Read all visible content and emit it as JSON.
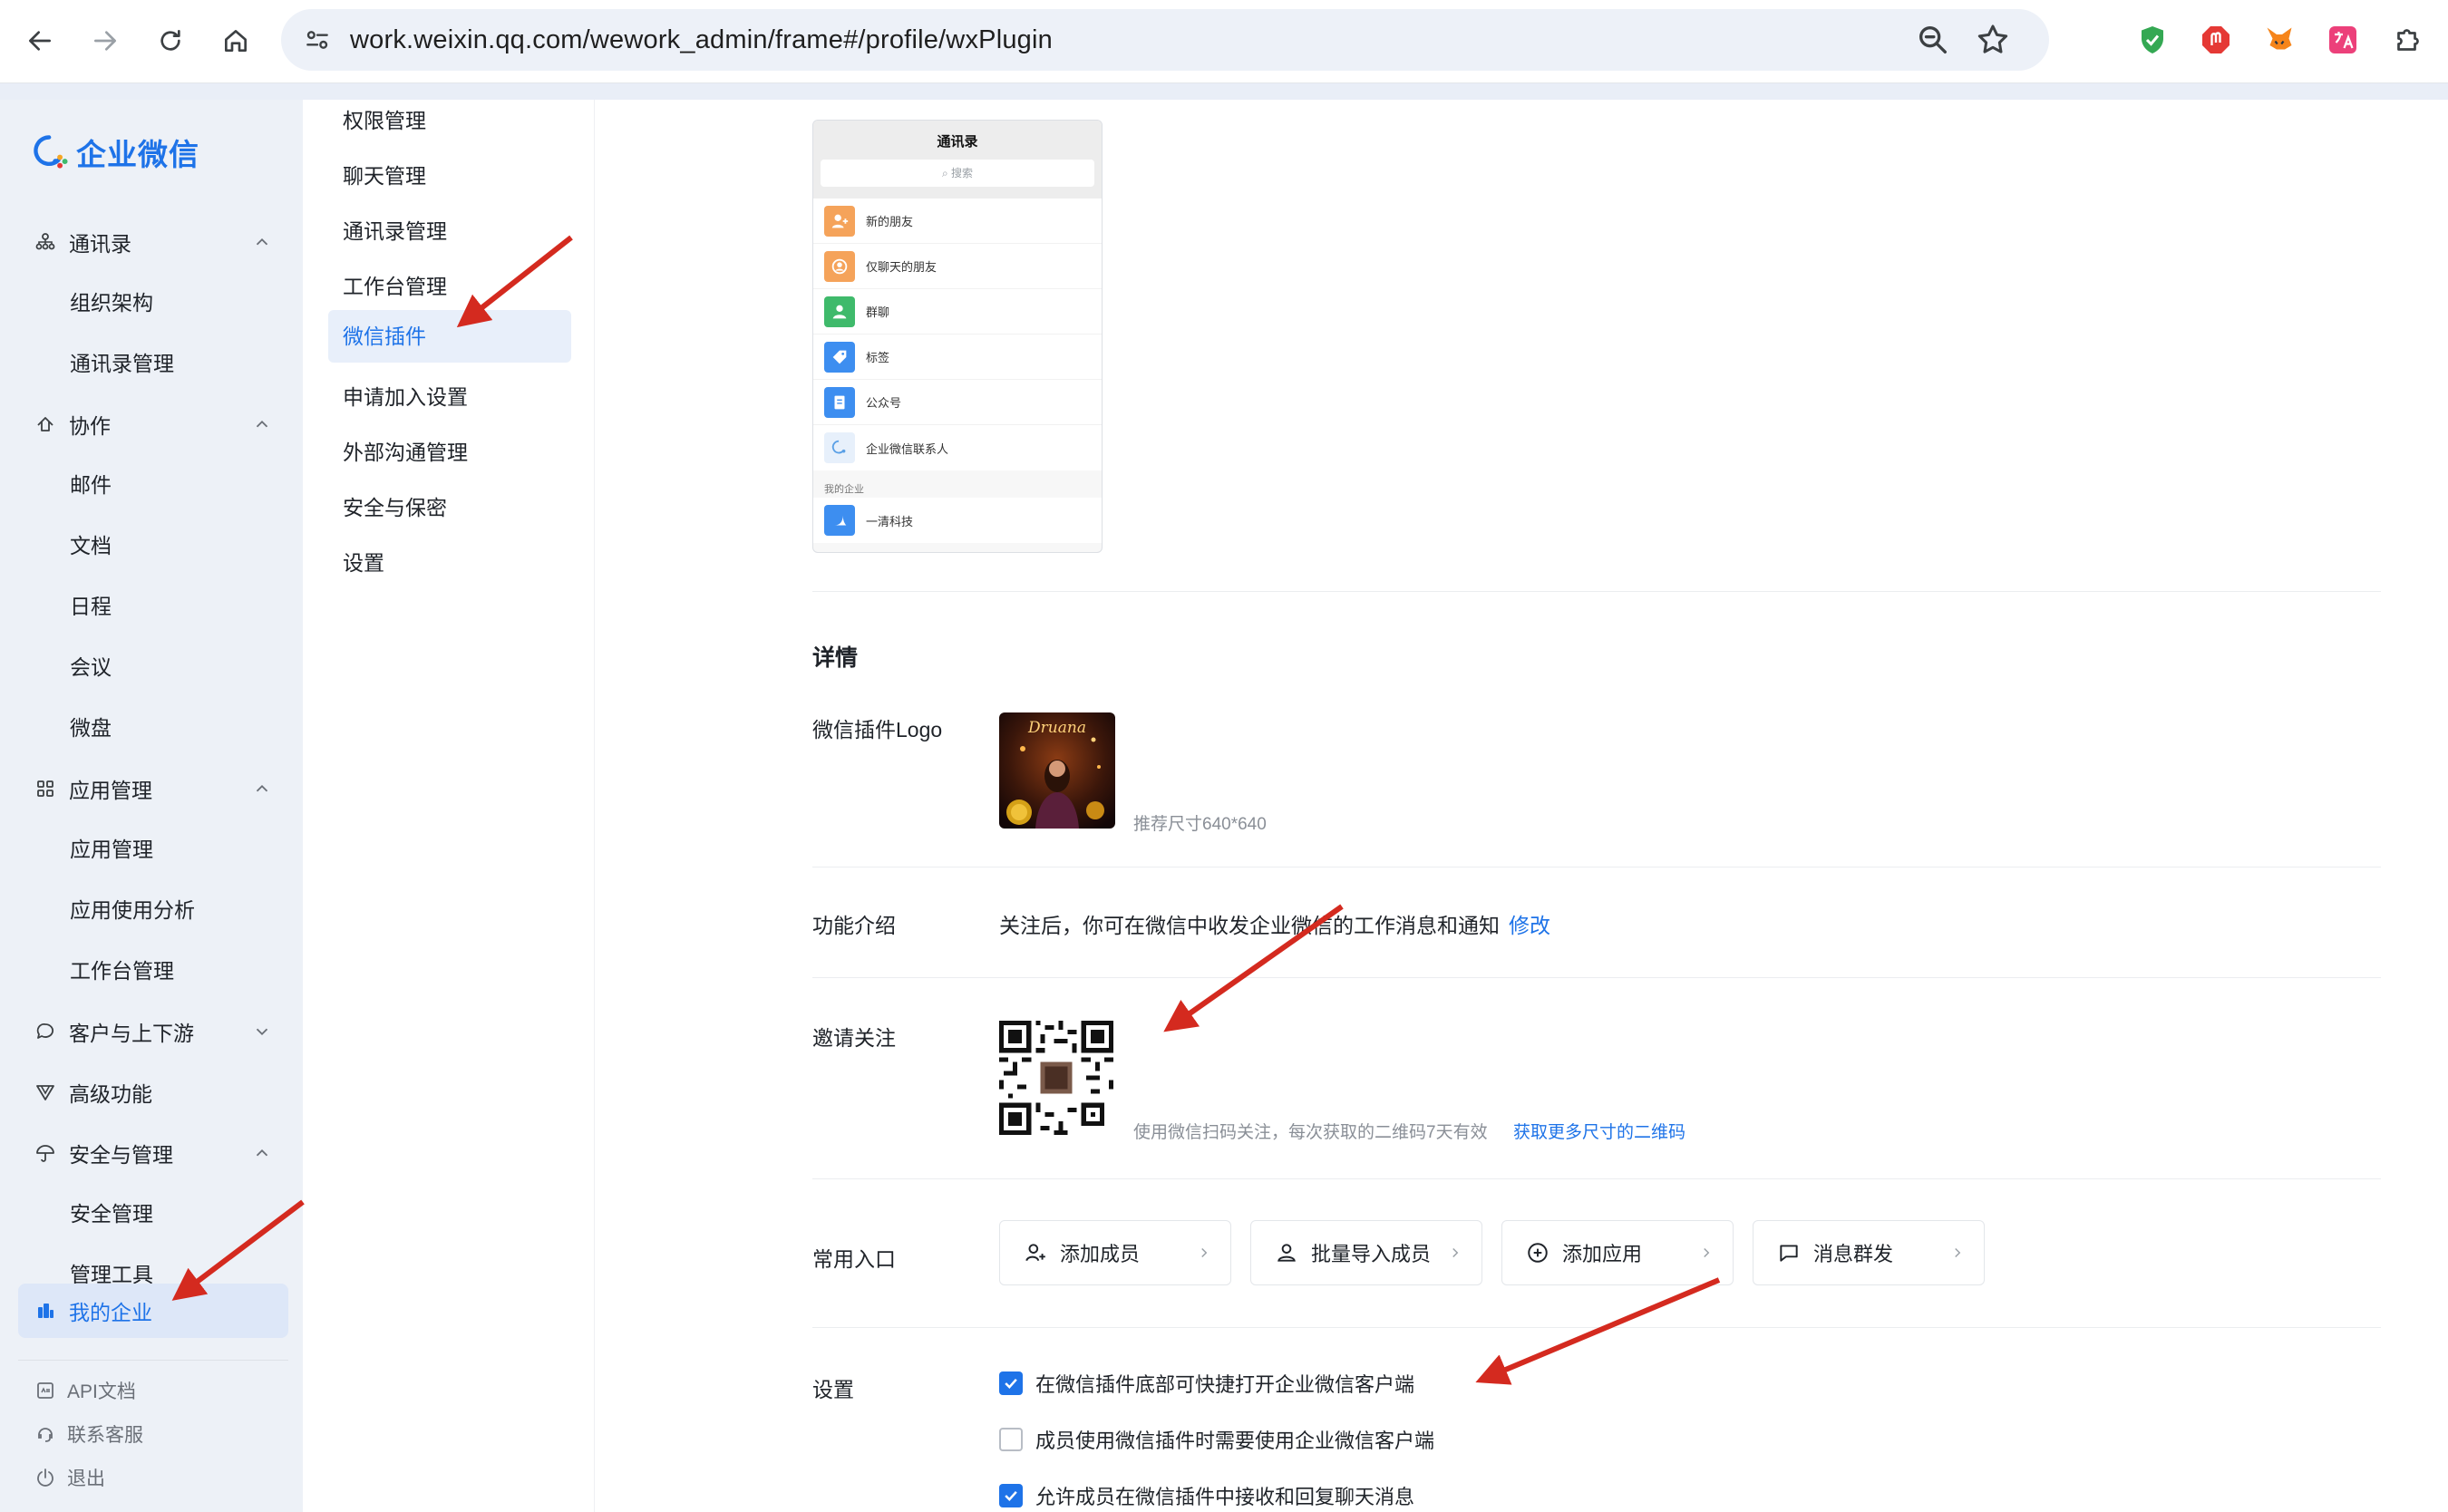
{
  "browser": {
    "url": "work.weixin.qq.com/wework_admin/frame#/profile/wxPlugin"
  },
  "brand": {
    "name": "企业微信",
    "accent": "#1e73e8"
  },
  "sidebar": {
    "groups": [
      {
        "label": "通讯录",
        "icon": "contacts-icon",
        "expanded": true,
        "items": [
          "组织架构",
          "通讯录管理"
        ]
      },
      {
        "label": "协作",
        "icon": "collaborate-icon",
        "expanded": true,
        "items": [
          "邮件",
          "文档",
          "日程",
          "会议",
          "微盘"
        ]
      },
      {
        "label": "应用管理",
        "icon": "apps-grid-icon",
        "expanded": true,
        "items": [
          "应用管理",
          "应用使用分析",
          "工作台管理"
        ]
      },
      {
        "label": "客户与上下游",
        "icon": "chat-bubble-icon",
        "expanded": false,
        "items": []
      },
      {
        "label": "高级功能",
        "icon": "advanced-icon",
        "expanded": false,
        "items": []
      },
      {
        "label": "安全与管理",
        "icon": "umbrella-icon",
        "expanded": true,
        "items": [
          "安全管理",
          "管理工具"
        ]
      }
    ],
    "active": "我的企业",
    "footer": [
      "API文档",
      "联系客服",
      "退出"
    ]
  },
  "subnav": {
    "items": [
      "权限管理",
      "聊天管理",
      "通讯录管理",
      "工作台管理",
      "微信插件",
      "申请加入设置",
      "外部沟通管理",
      "安全与保密",
      "设置"
    ],
    "active": "微信插件"
  },
  "preview": {
    "title": "通讯录",
    "search": "搜索",
    "rows": [
      {
        "label": "新的朋友",
        "color": "#f5a35a"
      },
      {
        "label": "仅聊天的朋友",
        "color": "#f5a35a"
      },
      {
        "label": "群聊",
        "color": "#3fba6b"
      },
      {
        "label": "标签",
        "color": "#3d8ef0"
      },
      {
        "label": "公众号",
        "color": "#3d8ef0"
      },
      {
        "label": "企业微信联系人",
        "color": "#5aa0e6"
      }
    ],
    "section": "我的企业",
    "company": "一清科技"
  },
  "details": {
    "title": "详情",
    "logo_label": "微信插件Logo",
    "logo_image_text": "Druana",
    "logo_hint": "推荐尺寸640*640",
    "intro_label": "功能介绍",
    "intro_text": "关注后，你可在微信中收发企业微信的工作消息和通知",
    "intro_edit": "修改",
    "invite_label": "邀请关注",
    "invite_hint": "使用微信扫码关注，每次获取的二维码7天有效",
    "invite_link": "获取更多尺寸的二维码",
    "entries_label": "常用入口",
    "entries": [
      {
        "label": "添加成员",
        "icon": "add-member-icon"
      },
      {
        "label": "批量导入成员",
        "icon": "import-members-icon"
      },
      {
        "label": "添加应用",
        "icon": "add-app-icon"
      },
      {
        "label": "消息群发",
        "icon": "broadcast-icon"
      }
    ],
    "settings_label": "设置",
    "settings": [
      {
        "label": "在微信插件底部可快捷打开企业微信客户端",
        "checked": true
      },
      {
        "label": "成员使用微信插件时需要使用企业微信客户端",
        "checked": false
      },
      {
        "label": "允许成员在微信插件中接收和回复聊天消息",
        "checked": true
      }
    ]
  }
}
